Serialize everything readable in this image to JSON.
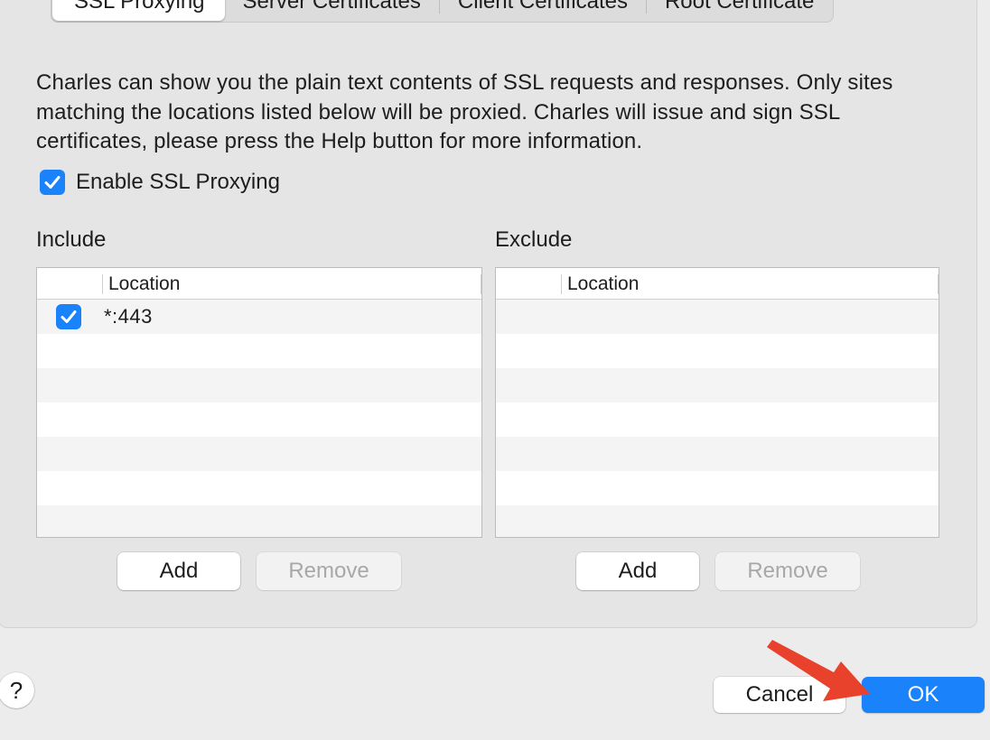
{
  "tabs": [
    {
      "label": "SSL Proxying",
      "active": true
    },
    {
      "label": "Server Certificates",
      "active": false
    },
    {
      "label": "Client Certificates",
      "active": false
    },
    {
      "label": "Root Certificate",
      "active": false
    }
  ],
  "description": "Charles can show you the plain text contents of SSL requests and responses. Only sites matching the locations listed below will be proxied. Charles will issue and sign SSL certificates, please press the Help button for more information.",
  "enable_ssl": {
    "label": "Enable SSL Proxying",
    "checked": true
  },
  "include": {
    "label": "Include",
    "column_header": "Location",
    "rows": [
      {
        "checked": true,
        "location": "*:443"
      }
    ],
    "add_label": "Add",
    "remove_label": "Remove"
  },
  "exclude": {
    "label": "Exclude",
    "column_header": "Location",
    "rows": [],
    "add_label": "Add",
    "remove_label": "Remove"
  },
  "footer": {
    "help_label": "?",
    "cancel_label": "Cancel",
    "ok_label": "OK"
  },
  "colors": {
    "accent": "#1a82fb",
    "annotation_arrow": "#e8412c"
  }
}
